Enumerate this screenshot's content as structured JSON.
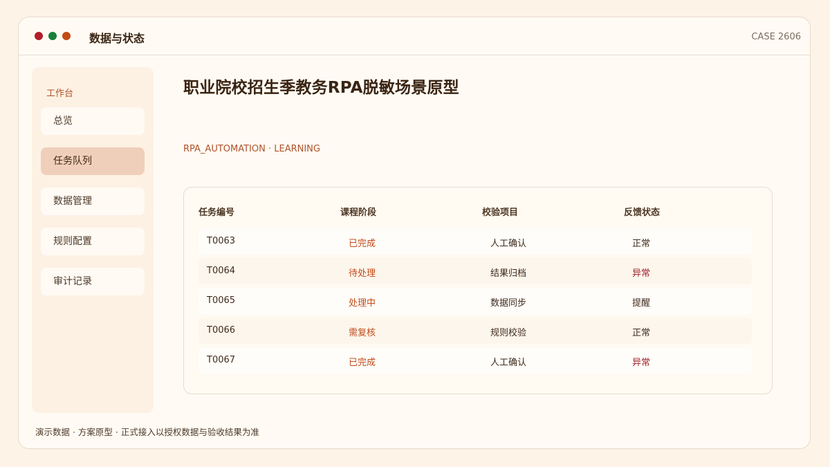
{
  "window": {
    "app_title": "数据与状态",
    "case_id": "CASE 2606"
  },
  "sidebar": {
    "heading": "工作台",
    "items": [
      {
        "label": "总览",
        "active": false
      },
      {
        "label": "任务队列",
        "active": true
      },
      {
        "label": "数据管理",
        "active": false
      },
      {
        "label": "规则配置",
        "active": false
      },
      {
        "label": "审计记录",
        "active": false
      }
    ]
  },
  "main": {
    "title": "职业院校招生季教务RPA脱敏场景原型",
    "tags": "RPA_AUTOMATION · LEARNING",
    "table": {
      "headers": [
        "任务编号",
        "课程阶段",
        "校验项目",
        "反馈状态"
      ],
      "rows": [
        {
          "id": "T0063",
          "stage": "已完成",
          "item": "人工确认",
          "status": "正常"
        },
        {
          "id": "T0064",
          "stage": "待处理",
          "item": "结果归档",
          "status": "异常"
        },
        {
          "id": "T0065",
          "stage": "处理中",
          "item": "数据同步",
          "status": "提醒"
        },
        {
          "id": "T0066",
          "stage": "需复核",
          "item": "规则校验",
          "status": "正常"
        },
        {
          "id": "T0067",
          "stage": "已完成",
          "item": "人工确认",
          "status": "异常"
        }
      ]
    }
  },
  "footer": {
    "note": "演示数据 · 方案原型 · 正式接入以授权数据与验收结果为准"
  },
  "colors": {
    "accent": "#b0522a",
    "active_nav": "#f0cfba",
    "status_abnormal": "#a0212c",
    "dot_red": "#b1202a",
    "dot_green": "#17803a",
    "dot_orange": "#c24b14"
  }
}
